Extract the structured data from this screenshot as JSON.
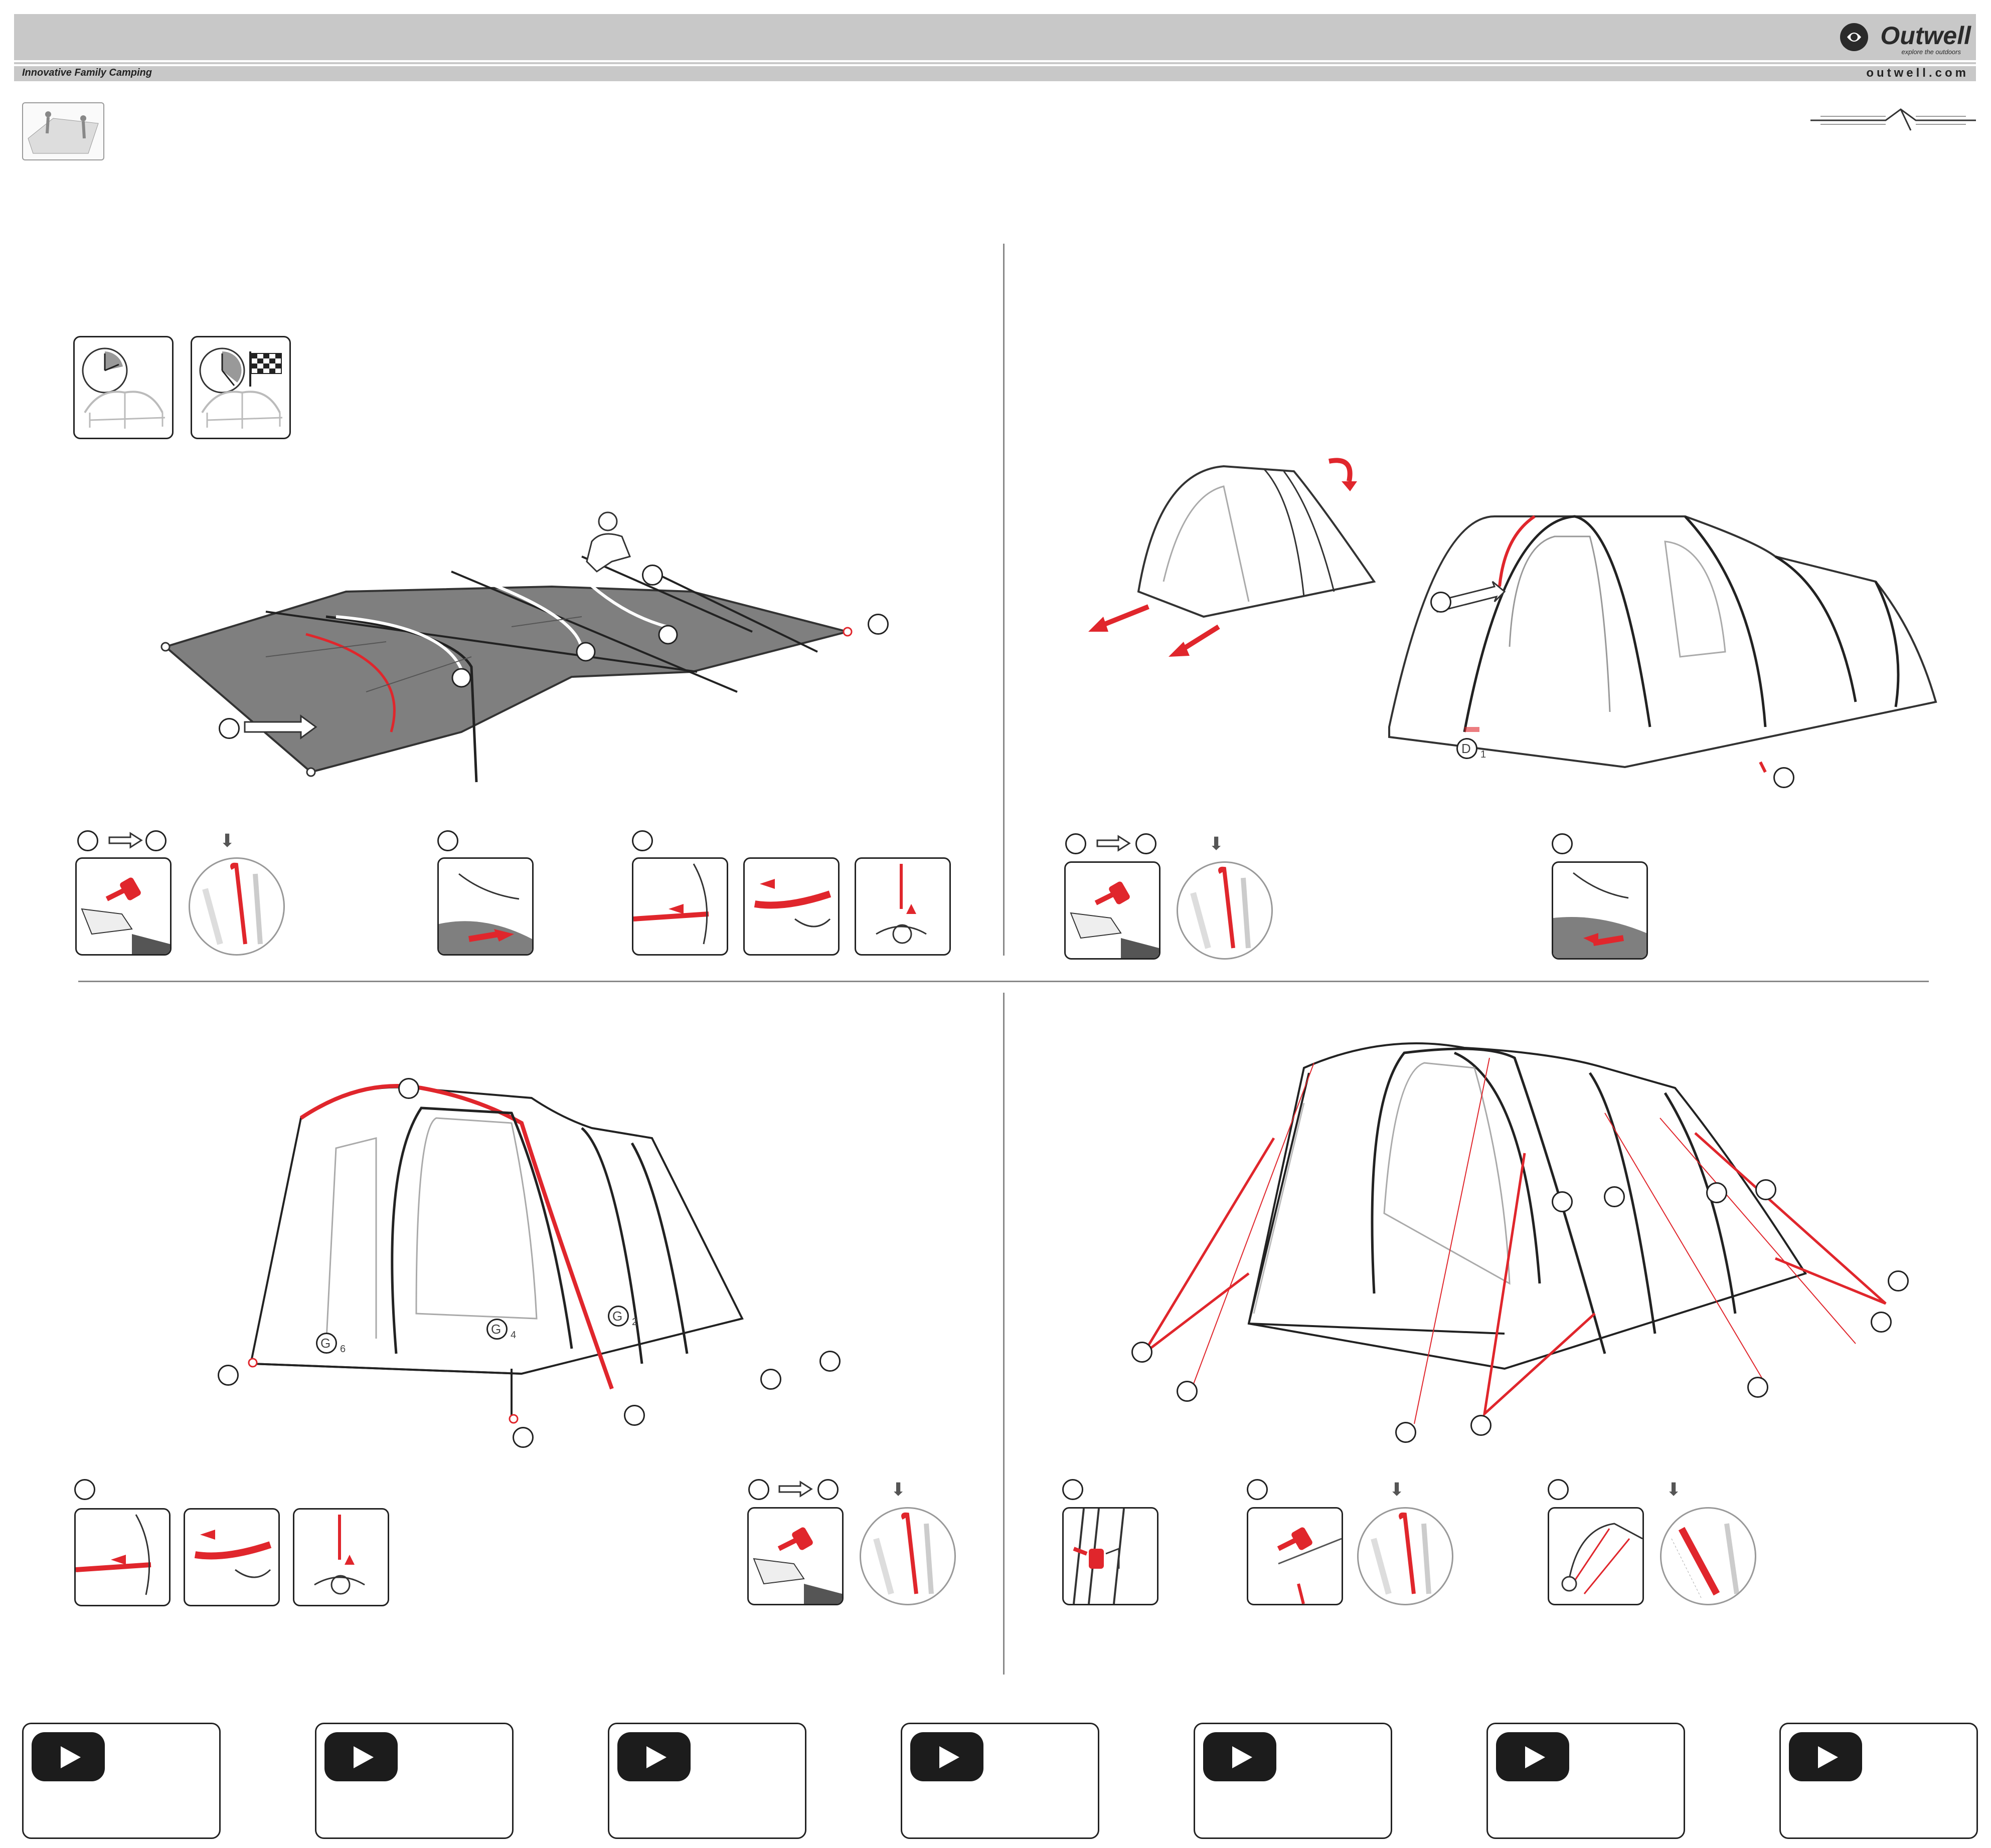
{
  "header": {
    "brand": "Outwell",
    "brand_tagline": "explore the outdoors",
    "tagline": "Innovative Family Camping",
    "website": "outwell.com"
  },
  "step_markers": {
    "d1_letter": "D",
    "d1_sub": "1",
    "g6_letter": "G",
    "g6_sub": "6",
    "g4_letter": "G",
    "g4_sub": "4",
    "g2_letter": "G",
    "g2_sub": "2"
  },
  "video_buttons": [
    {
      "icon": "play-icon"
    },
    {
      "icon": "play-icon"
    },
    {
      "icon": "play-icon"
    },
    {
      "icon": "play-icon"
    },
    {
      "icon": "play-icon"
    },
    {
      "icon": "play-icon"
    },
    {
      "icon": "play-icon"
    }
  ],
  "colors": {
    "accent": "#e0262c",
    "groundsheet": "#7f7f7f",
    "header_bar": "#c8c8c8",
    "ink": "#222222"
  }
}
